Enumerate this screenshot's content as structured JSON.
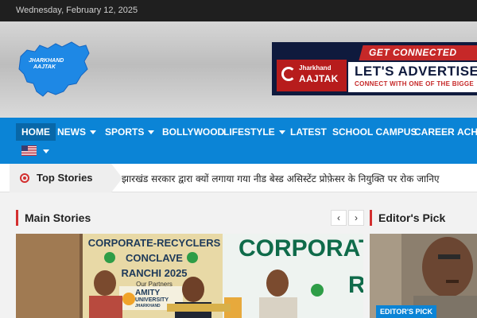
{
  "topbar": {
    "date": "Wednesday, February 12, 2025"
  },
  "logo": {
    "text_line1": "JHARKHAND",
    "text_line2": "AAJTAK"
  },
  "ad": {
    "ribbon": "GET CONNECTED",
    "brand_line1": "Jharkhand",
    "brand_line2": "AAJTAK",
    "headline": "LET'S ADVERTISE",
    "subline": "CONNECT WITH ONE OF THE BIGGE"
  },
  "nav": {
    "items": [
      {
        "label": "HOME",
        "active": true
      },
      {
        "label": "NEWS",
        "dropdown": true
      },
      {
        "label": "SPORTS",
        "dropdown": true
      },
      {
        "label": "BOLLYWOOD"
      },
      {
        "label": "LIFESTYLE",
        "dropdown": true
      },
      {
        "label": "LATEST"
      },
      {
        "label": "SCHOOL CAMPUS"
      },
      {
        "label": "CAREER"
      },
      {
        "label": "ACH"
      }
    ],
    "language_icon": "us-flag-icon"
  },
  "ticker": {
    "label": "Top Stories",
    "headline": "झारखंड सरकार द्वारा क्यों लगाया गया नीड बेस्ड असिस्टेंट प्रोफ़ेसर के नियुक्ति पर रोक जानिए"
  },
  "main": {
    "title": "Main Stories",
    "prev_icon": "chevron-left-icon",
    "next_icon": "chevron-right-icon",
    "photo": {
      "banner1_line1": "CORPORATE-RECYCLERS",
      "banner1_line2": "CONCLAVE",
      "banner1_line3": "RANCHI 2025",
      "banner1_partners": "Our Partners",
      "banner1_sponsor": "AMITY",
      "banner1_sponsor_sub": "UNIVERSITY",
      "banner1_sponsor_place": "JHARKHAND",
      "banner2_title": "CORPORATE-",
      "banner2_partial": "R"
    }
  },
  "sidebar": {
    "title": "Editor's Pick",
    "badge": "EDITOR'S PICK"
  },
  "colors": {
    "nav_blue": "#0b84d6",
    "accent_red": "#d32f2f",
    "topbar_dark": "#1f1f1f"
  }
}
